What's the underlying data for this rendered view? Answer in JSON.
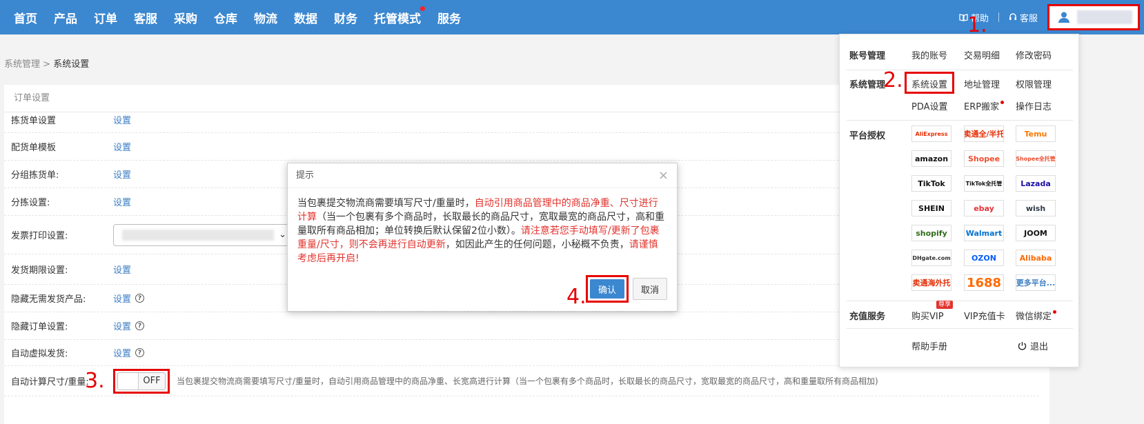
{
  "nav": {
    "items": [
      "首页",
      "产品",
      "订单",
      "客服",
      "采购",
      "仓库",
      "物流",
      "数据",
      "财务",
      "托管模式",
      "服务"
    ],
    "help": "帮助",
    "service": "客服"
  },
  "steps": {
    "s1": "1.",
    "s2": "2.",
    "s3": "3.",
    "s4": "4."
  },
  "breadcrumb": {
    "parent": "系统管理",
    "sep": " > ",
    "current": "系统设置"
  },
  "panel": {
    "title": "订单设置",
    "rows": [
      {
        "label": "拣货单设置",
        "link": "设置"
      },
      {
        "label": "配货单模板",
        "link": "设置"
      },
      {
        "label": "分组拣货单:",
        "link": "设置"
      },
      {
        "label": "分拣设置:",
        "link": "设置"
      },
      {
        "label": "发票打印设置:"
      },
      {
        "label": "发货期限设置:",
        "link": "设置"
      },
      {
        "label": "隐藏无需发货产品:",
        "link": "设置"
      },
      {
        "label": "隐藏订单设置:",
        "link": "设置"
      },
      {
        "label": "自动虚拟发货:",
        "link": "设置"
      },
      {
        "label": "自动计算尺寸/重量:",
        "toggle": "OFF",
        "desc": "当包裹提交物流商需要填写尺寸/重量时，自动引用商品管理中的商品净重、长宽高进行计算（当一个包裹有多个商品时，长取最长的商品尺寸，宽取最宽的商品尺寸，高和重量取所有商品相加)"
      }
    ]
  },
  "dialog": {
    "title": "提示",
    "close": "×",
    "p1": "当包裹提交物流商需要填写尺寸/重量时，",
    "p2": "自动引用商品管理中的商品净重、尺寸进行计算",
    "p3": "（当一个包裹有多个商品时，长取最长的商品尺寸，宽取最宽的商品尺寸，高和重量取所有商品相加；单位转换后默认保留2位小数）。",
    "p4": "请注意若您手动填写/更新了包裹重量/尺寸，则不会再进行自动更新",
    "p5": "，如因此产生的任何问题，小秘概不负责，",
    "p6": "请谨慎考虑后再开启!",
    "ok": "确认",
    "cancel": "取消"
  },
  "menu": {
    "account": {
      "title": "账号管理",
      "links": [
        "我的账号",
        "交易明细",
        "修改密码"
      ]
    },
    "system": {
      "title": "系统管理",
      "links": [
        "系统设置",
        "地址管理",
        "权限管理",
        "PDA设置",
        "ERP搬家",
        "操作日志"
      ]
    },
    "platform": {
      "title": "平台授权",
      "items": [
        {
          "name": "AliExpress",
          "color": "#e62e04"
        },
        {
          "name": "速卖通全/半托管",
          "color": "#e62e04"
        },
        {
          "name": "Temu",
          "color": "#fb7701"
        },
        {
          "name": "amazon",
          "color": "#111111"
        },
        {
          "name": "Shopee",
          "color": "#ee4d2d"
        },
        {
          "name": "Shopee全托管",
          "color": "#ee4d2d"
        },
        {
          "name": "TikTok",
          "color": "#111111"
        },
        {
          "name": "TikTok全托管",
          "color": "#111111"
        },
        {
          "name": "Lazada",
          "color": "#1a0fa3"
        },
        {
          "name": "SHEIN",
          "color": "#111111"
        },
        {
          "name": "ebay",
          "color": "#e53238"
        },
        {
          "name": "wish",
          "color": "#2f3a45"
        },
        {
          "name": "shopify",
          "color": "#2e6b19"
        },
        {
          "name": "Walmart",
          "color": "#0071ce"
        },
        {
          "name": "JOOM",
          "color": "#111111"
        },
        {
          "name": "DHgate.com",
          "color": "#333333"
        },
        {
          "name": "OZON",
          "color": "#005bff"
        },
        {
          "name": "Alibaba",
          "color": "#ff6a00"
        },
        {
          "name": "速卖通海外托管",
          "color": "#e62e04"
        },
        {
          "name": "1688",
          "color": "#ff6a00"
        },
        {
          "name": "更多平台...",
          "color": "#3b7dc4"
        }
      ]
    },
    "recharge": {
      "title": "充值服务",
      "links": [
        "购买VIP",
        "VIP充值卡",
        "微信绑定"
      ],
      "vip_tag": "尊享"
    },
    "footer": {
      "manual": "帮助手册",
      "logout": "退出"
    }
  }
}
